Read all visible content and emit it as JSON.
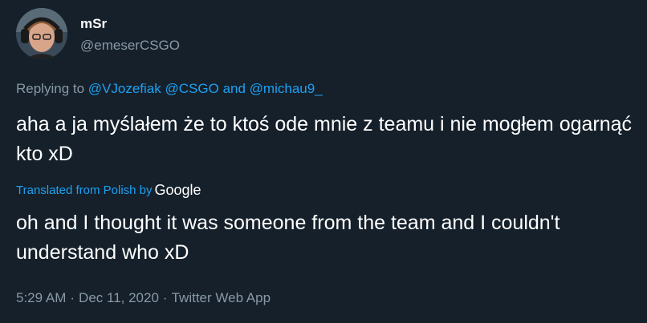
{
  "author": {
    "display_name": "mSr",
    "handle": "@emeserCSGO"
  },
  "reply": {
    "prefix": "Replying to",
    "mention_1": "@VJozefiak",
    "mention_2": "@CSGO",
    "and": "and",
    "mention_3": "@michau9_"
  },
  "tweet": {
    "text": "aha a ja myślałem że to ktoś ode mnie z teamu i nie mogłem ogarnąć kto xD",
    "translated_label": "Translated from Polish by",
    "translator": "Google",
    "translation": "oh and I thought it was someone from the team and I couldn't understand who xD"
  },
  "meta": {
    "time": "5:29 AM",
    "separator": "·",
    "date": "Dec 11, 2020",
    "source": "Twitter Web App"
  },
  "colors": {
    "background": "#15202b",
    "text": "#ffffff",
    "secondary": "#8899a6",
    "link": "#1da1f2"
  }
}
